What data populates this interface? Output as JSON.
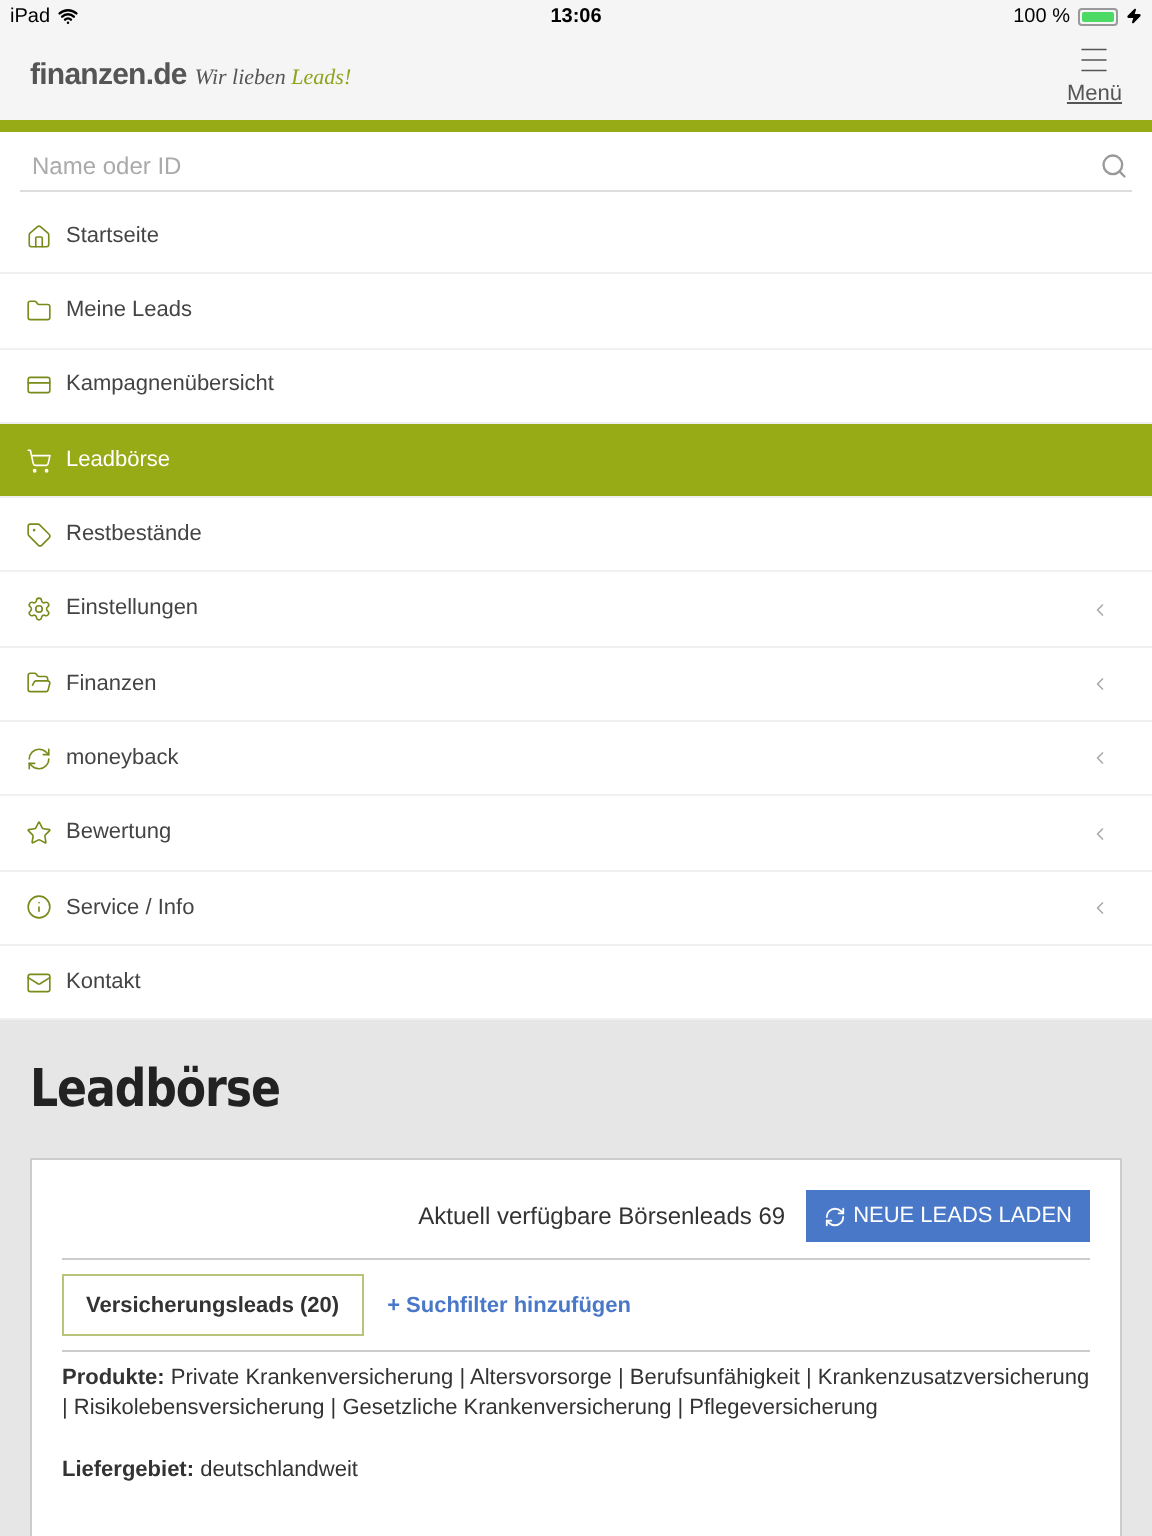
{
  "status_bar": {
    "device": "iPad",
    "time": "13:06",
    "battery": "100 %"
  },
  "header": {
    "logo": "finanzen.de",
    "tagline": "Wir lieben *Leads!*",
    "menu_label": "Menü"
  },
  "search": {
    "placeholder": "Name oder ID"
  },
  "menu": [
    {
      "label": "Startseite",
      "selected": false,
      "expandable": false
    },
    {
      "label": "Meine Leads",
      "selected": false,
      "expandable": false
    },
    {
      "label": "Kampagnenübersicht",
      "selected": false,
      "expandable": false
    },
    {
      "label": "Leadbörse",
      "selected": true,
      "expandable": false
    },
    {
      "label": "Restbestände",
      "selected": false,
      "expandable": false
    },
    {
      "label": "Einstellungen",
      "selected": false,
      "expandable": true
    },
    {
      "label": "Finanzen",
      "selected": false,
      "expandable": true
    },
    {
      "label": "moneyback",
      "selected": false,
      "expandable": true
    },
    {
      "label": "Bewertung",
      "selected": false,
      "expandable": true
    },
    {
      "label": "Service / Info",
      "selected": false,
      "expandable": true
    },
    {
      "label": "Kontakt",
      "selected": false,
      "expandable": false
    }
  ],
  "page": {
    "title": "Leadbörse",
    "available": "Aktuell verfügbare Börsenleads 69",
    "reload_button": "NEUE LEADS LADEN",
    "filter_tabs": [
      {
        "label": "Versicherungsleads (20)",
        "selected": true
      }
    ],
    "add_filter": "+ Suchfilter hinzufügen",
    "details": [
      "**Produkte:** Private Krankenversicherung | Altersvorsorge | Berufsunfähigkeit | Krankenzusatzversicherung | Risikolebensversicherung | Gesetzliche Krankenversicherung | Pflegeversicherung",
      "**Liefergebiet:** deutschlandweit"
    ]
  }
}
